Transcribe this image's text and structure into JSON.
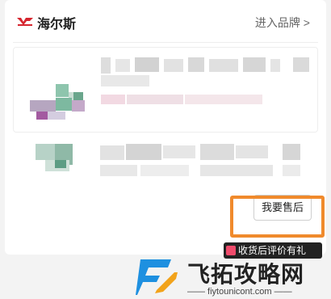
{
  "brand": {
    "name": "海尔斯",
    "link_label": "进入品牌 >"
  },
  "products": [
    {
      "title": "",
      "spec": ""
    },
    {
      "title": "",
      "spec": ""
    }
  ],
  "actions": {
    "after_sale_label": "我要售后"
  },
  "banner": {
    "text": "收货后评价有礼"
  },
  "watermark": {
    "title": "飞拓攻略网",
    "subtitle": "—— fiytounicont.com ——"
  },
  "colors": {
    "highlight": "#f08a2c",
    "brand_red": "#d6262f",
    "watermark_blue": "#1e90e0",
    "banner_bg": "#222222"
  }
}
